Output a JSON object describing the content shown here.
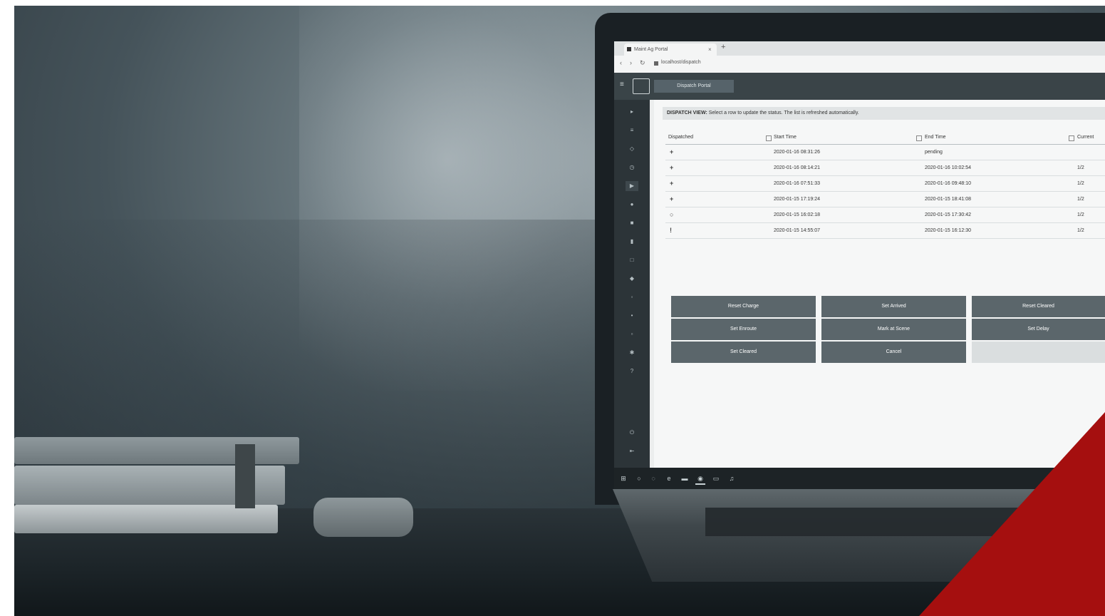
{
  "browser": {
    "tab_title": "Maint Ag Portal",
    "tab_close": "×",
    "new_tab": "+",
    "url": "localhost/dispatch"
  },
  "app": {
    "menu_icon": "hamburger-icon",
    "header_button": "Dispatch Portal"
  },
  "notice": {
    "bold": "DISPATCH VIEW:",
    "text": "Select a row to update the status. The list is refreshed automatically."
  },
  "grid": {
    "headers": [
      "Dispatched",
      "Start Time",
      "End Time",
      "Current"
    ],
    "rows": [
      {
        "icon": "+",
        "start": "2020-01-16 08:31:26",
        "end": "pending",
        "cur": ""
      },
      {
        "icon": "+",
        "start": "2020-01-16 08:14:21",
        "end": "2020-01-16 10:02:54",
        "cur": "1/2"
      },
      {
        "icon": "+",
        "start": "2020-01-16 07:51:33",
        "end": "2020-01-16 09:48:10",
        "cur": "1/2"
      },
      {
        "icon": "+",
        "start": "2020-01-15 17:19:24",
        "end": "2020-01-15 18:41:08",
        "cur": "1/2"
      },
      {
        "icon": "○",
        "start": "2020-01-15 16:02:18",
        "end": "2020-01-15 17:30:42",
        "cur": "1/2"
      },
      {
        "icon": "!",
        "start": "2020-01-15 14:55:07",
        "end": "2020-01-15 16:12:30",
        "cur": "1/2"
      }
    ]
  },
  "actions": [
    "Reset Charge",
    "Set Arrived",
    "Reset Cleared",
    "Set Enroute",
    "Mark at Scene",
    "Set Delay",
    "Set Cleared",
    "Cancel"
  ],
  "colors": {
    "accent_red": "#a50f0f",
    "app_header": "#3a4448",
    "button": "#5b666b"
  }
}
